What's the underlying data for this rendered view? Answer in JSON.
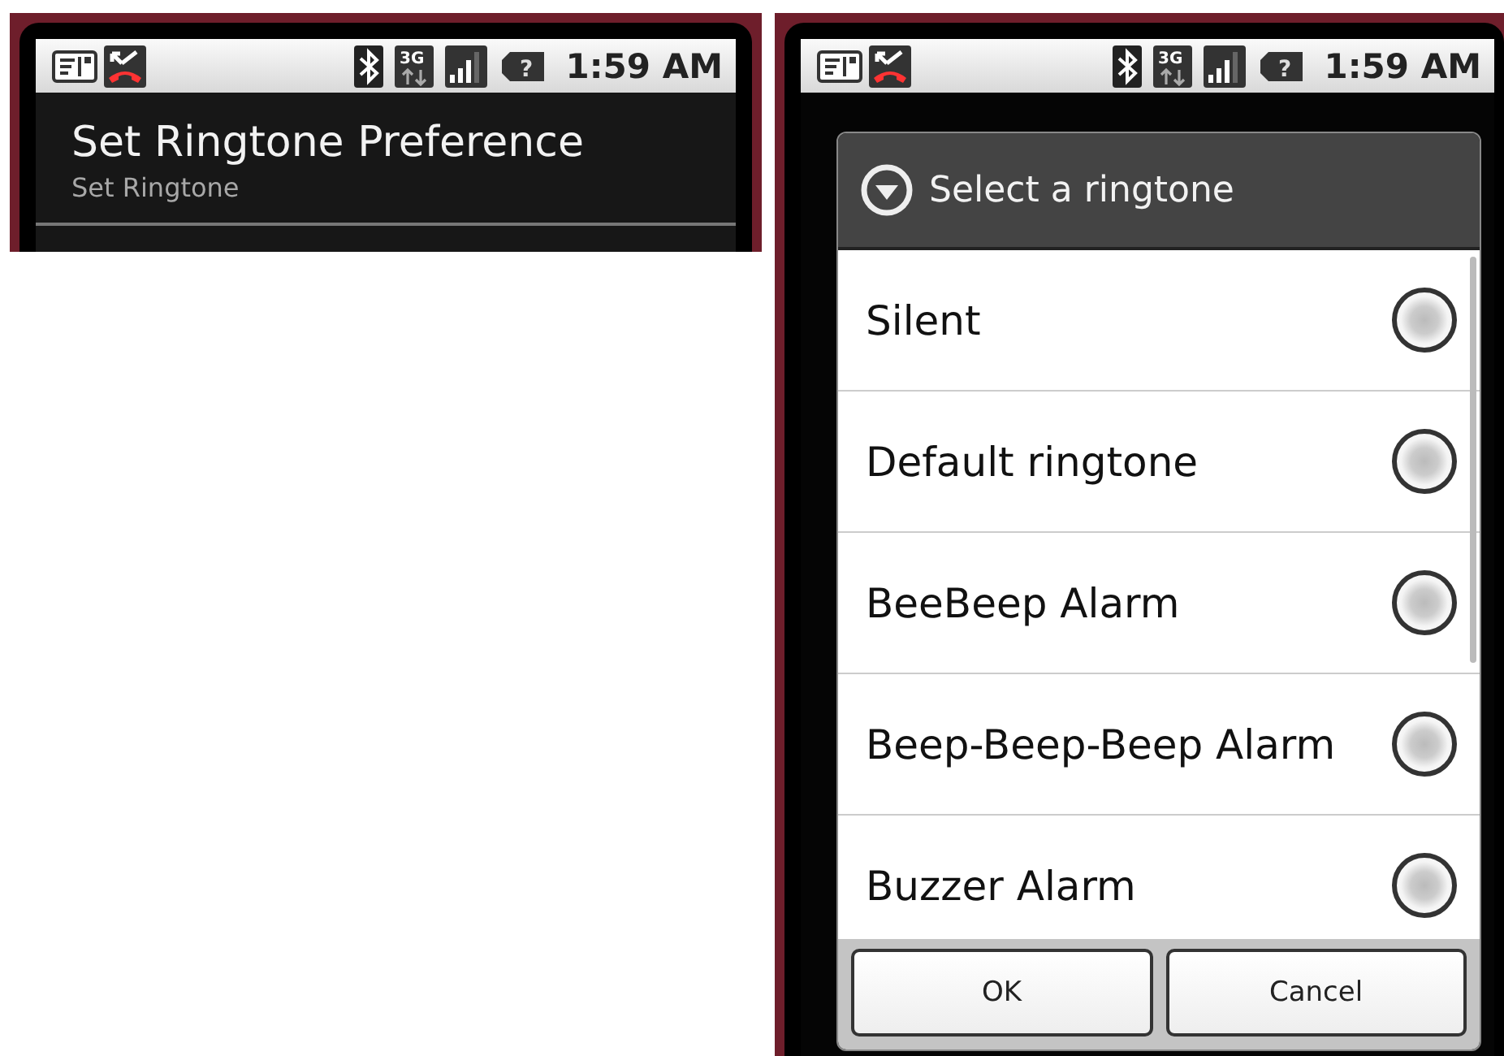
{
  "left_screen": {
    "status_bar": {
      "network": "3G",
      "battery": "?",
      "time": "1:59 AM"
    },
    "title": "Set Ringtone Preference",
    "summary": "Set Ringtone"
  },
  "right_screen": {
    "status_bar": {
      "network": "3G",
      "battery": "?",
      "time": "1:59 AM"
    },
    "dialog": {
      "title": "Select a ringtone",
      "options": [
        {
          "label": "Silent",
          "selected": false
        },
        {
          "label": "Default ringtone",
          "selected": false
        },
        {
          "label": "BeeBeep Alarm",
          "selected": false
        },
        {
          "label": "Beep-Beep-Beep Alarm",
          "selected": false
        },
        {
          "label": "Buzzer Alarm",
          "selected": false
        }
      ],
      "buttons": [
        "OK",
        "Cancel"
      ]
    }
  }
}
